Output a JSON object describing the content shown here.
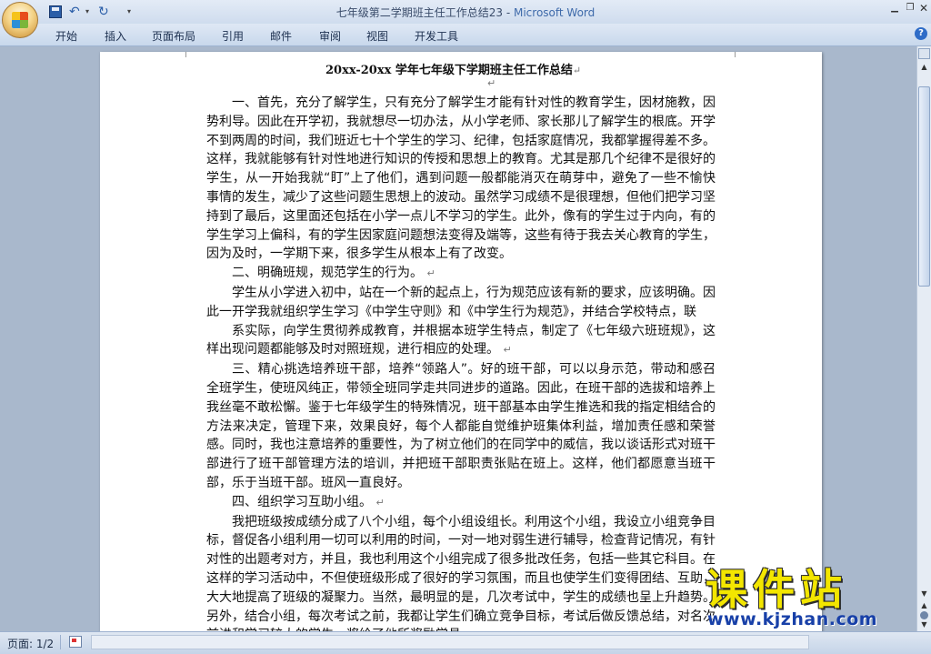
{
  "window": {
    "doc_name": "七年级第二学期班主任工作总结23",
    "separator": " - ",
    "app_name": "Microsoft Word"
  },
  "ribbon": {
    "tabs": [
      "开始",
      "插入",
      "页面布局",
      "引用",
      "邮件",
      "审阅",
      "视图",
      "开发工具"
    ]
  },
  "document": {
    "title": "20xx-20xx 学年七年级下学期班主任工作总结",
    "paragraph_mark": "↵",
    "paragraphs": [
      "一、首先，充分了解学生，只有充分了解学生才能有针对性的教育学生，因材施教，因势利导。因此在开学初，我就想尽一切办法，从小学老师、家长那儿了解学生的根底。开学不到两周的时间，我们班近七十个学生的学习、纪律，包括家庭情况，我都掌握得差不多。这样，我就能够有针对性地进行知识的传授和思想上的教育。尤其是那几个纪律不是很好的学生，从一开始我就“盯”上了他们，遇到问题一般都能消灭在萌芽中，避免了一些不愉快事情的发生，减少了这些问题生思想上的波动。虽然学习成绩不是很理想，但他们把学习坚持到了最后，这里面还包括在小学一点儿不学习的学生。此外，像有的学生过于内向，有的学生学习上偏科，有的学生因家庭问题想法变得及端等，这些有待于我去关心教育的学生，因为及时，一学期下来，很多学生从根本上有了改变。",
      "二、明确班规，规范学生的行为。",
      "学生从小学进入初中，站在一个新的起点上，行为规范应该有新的要求，应该明确。因此一开学我就组织学生学习《中学生守则》和《中学生行为规范》，并结合学校特点，联",
      "系实际，向学生贯彻养成教育，并根据本班学生特点，制定了《七年级六班班规》，这样出现问题都能够及时对照班规，进行相应的处理。",
      "三、精心挑选培养班干部，培养“领路人”。好的班干部，可以以身示范，带动和感召全班学生，使班风纯正，带领全班同学走共同进步的道路。因此，在班干部的选拔和培养上我丝毫不敢松懈。鉴于七年级学生的特殊情况，班干部基本由学生推选和我的指定相结合的方法来决定，管理下来，效果良好，每个人都能自觉维护班集体利益，增加责任感和荣誉感。同时，我也注意培养的重要性，为了树立他们的在同学中的威信，我以谈话形式对班干部进行了班干部管理方法的培训，并把班干部职责张贴在班上。这样，他们都愿意当班干部，乐于当班干部。班风一直良好。",
      "四、组织学习互助小组。",
      "我把班级按成绩分成了八个小组，每个小组设组长。利用这个小组，我设立小组竞争目标，督促各小组利用一切可以利用的时间，一对一地对弱生进行辅导，检查背记情况，有针对性的出题考对方，并且，我也利用这个小组完成了很多批改任务，包括一些其它科目。在这样的学习活动中，不但使班级形成了很好的学习氛围，而且也使学生们变得团结、互助，大大地提高了班级的凝聚力。当然，最明显的是，几次考试中，学生的成绩也呈上升趋势。另外，结合小组，每次考试之前，我都让学生们确立竞争目标，考试后做反馈总结，对名次前进和学习较大的学生，奖给了他所奖励学具。"
    ]
  },
  "statusbar": {
    "page_count": "页面: 1/2"
  },
  "watermark": {
    "site_name": "课件站",
    "url": "www.kjzhan.com"
  },
  "icons": [
    "office-button-icon",
    "save-icon",
    "undo-icon",
    "redo-icon",
    "help-icon",
    "minimize-icon",
    "maximize-icon",
    "close-icon",
    "proofing-icon"
  ]
}
